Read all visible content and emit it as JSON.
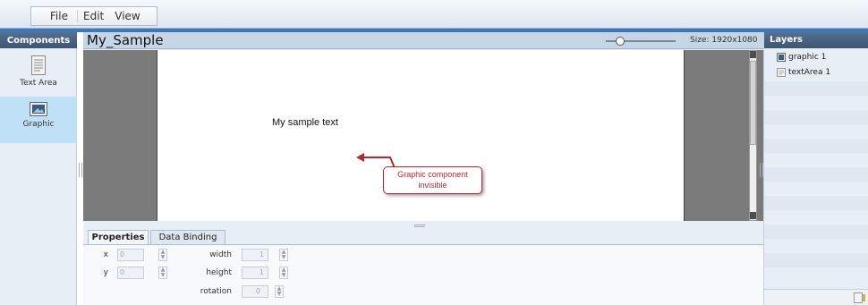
{
  "menu": {
    "file": "File",
    "edit": "Edit",
    "view": "View"
  },
  "components": {
    "header": "Components",
    "items": [
      {
        "label": "Text Area",
        "icon": "text-area-icon"
      },
      {
        "label": "Graphic",
        "icon": "graphic-icon"
      }
    ]
  },
  "document": {
    "title": "My_Sample",
    "size": "Size: 1920x1080",
    "sample_text": "My sample text",
    "callout": "Graphic component invisible",
    "zoom_level": 0.2
  },
  "properties": {
    "tabs": [
      "Properties",
      "Data Binding"
    ],
    "fields": {
      "x": {
        "label": "x",
        "value": "0"
      },
      "y": {
        "label": "y",
        "value": "0"
      },
      "width": {
        "label": "width",
        "value": "1"
      },
      "height": {
        "label": "height",
        "value": "1"
      },
      "rotation": {
        "label": "rotation",
        "value": "0"
      }
    }
  },
  "layers": {
    "header": "Layers",
    "items": [
      {
        "label": "graphic 1",
        "icon": "graphic-icon"
      },
      {
        "label": "textArea 1",
        "icon": "text-area-icon"
      }
    ]
  },
  "colors": {
    "accent": "#3d78b8",
    "header": "#3c5674",
    "selected": "#bfe0f7",
    "annotation": "#b7282e"
  }
}
